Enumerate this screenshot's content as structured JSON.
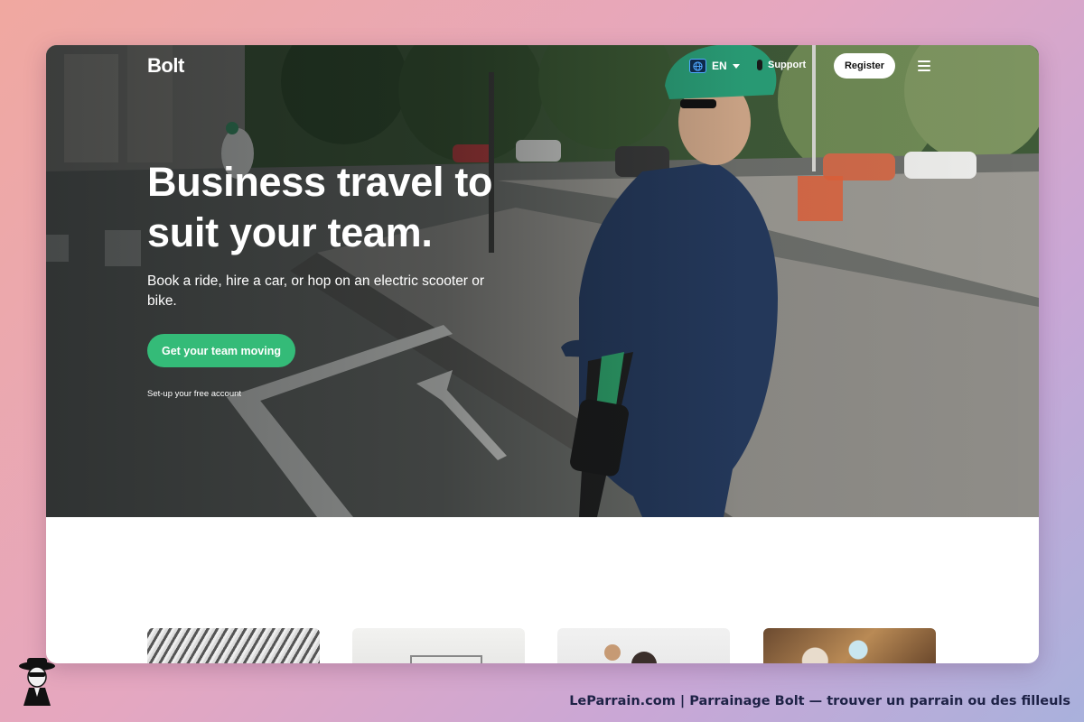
{
  "nav": {
    "logo": "Bolt",
    "language": "EN",
    "support": "Support",
    "register": "Register"
  },
  "hero": {
    "headline_line1": "Business travel to",
    "headline_line2": "suit your team.",
    "subtext": "Book a ride, hire a car, or hop on an electric scooter or bike.",
    "cta": "Get your team moving",
    "cta_note": "Set-up your free account"
  },
  "footer": {
    "caption": "LeParrain.com | Parrainage Bolt — trouver un parrain ou des filleuls"
  },
  "colors": {
    "accent_green": "#34bb78",
    "footer_text": "#1e2246"
  },
  "icons": [
    "globe-icon",
    "chevron-down-icon",
    "menu-icon",
    "mascot-icon"
  ]
}
